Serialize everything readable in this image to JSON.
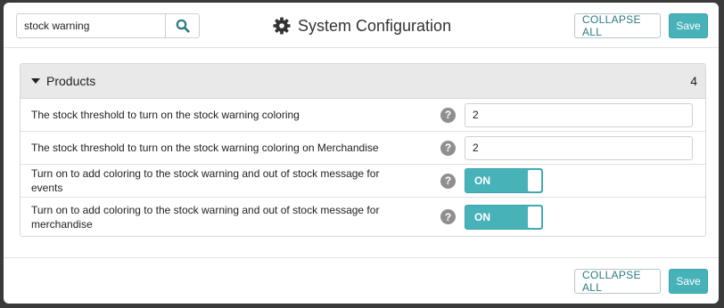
{
  "header": {
    "search_value": "stock warning",
    "title": "System Configuration",
    "collapse_all_label": "COLLAPSE ALL",
    "save_label": "Save"
  },
  "section": {
    "title": "Products",
    "count": "4",
    "rows": [
      {
        "label": "The stock threshold to turn on the stock warning coloring",
        "type": "number",
        "value": "2"
      },
      {
        "label": "The stock threshold to turn on the stock warning coloring on Merchandise",
        "type": "number",
        "value": "2"
      },
      {
        "label": "Turn on to add coloring to the stock warning and out of stock message for events",
        "type": "toggle",
        "value": "ON"
      },
      {
        "label": "Turn on to add coloring to the stock warning and out of stock message for merchandise",
        "type": "toggle",
        "value": "ON"
      }
    ]
  },
  "footer": {
    "collapse_all_label": "COLLAPSE ALL",
    "save_label": "Save"
  },
  "help_glyph": "?",
  "colors": {
    "accent": "#48b2b9",
    "accent_text": "#2b7a82",
    "panel_header": "#e9e9e9",
    "help_icon": "#8f8f8f"
  },
  "icons": {
    "search": "search-icon",
    "settings": "gear-icon",
    "collapse": "caret-down-icon",
    "help": "help-icon"
  }
}
